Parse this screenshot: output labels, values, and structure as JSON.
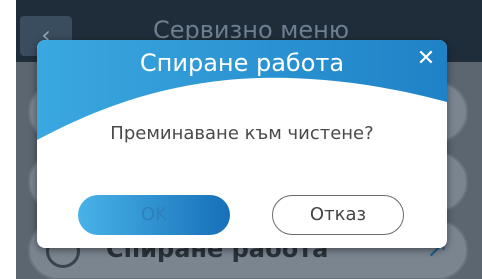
{
  "background": {
    "title": "Сервизно меню",
    "back_icon": "chevron-left-icon",
    "visible_row_label": "Спиране работа",
    "row_arrow_icon": "arrow-icon"
  },
  "dialog": {
    "title": "Спиране работа",
    "close_icon": "close-icon",
    "close_glyph": "✕",
    "message": "Преминаване към чистене?",
    "ok_label": "OK",
    "cancel_label": "Отказ"
  },
  "colors": {
    "header_blue": "#2a8fd0",
    "ok_gradient_start": "#48b3e8",
    "ok_gradient_end": "#176fb8",
    "topbar": "#1f2d3a"
  }
}
